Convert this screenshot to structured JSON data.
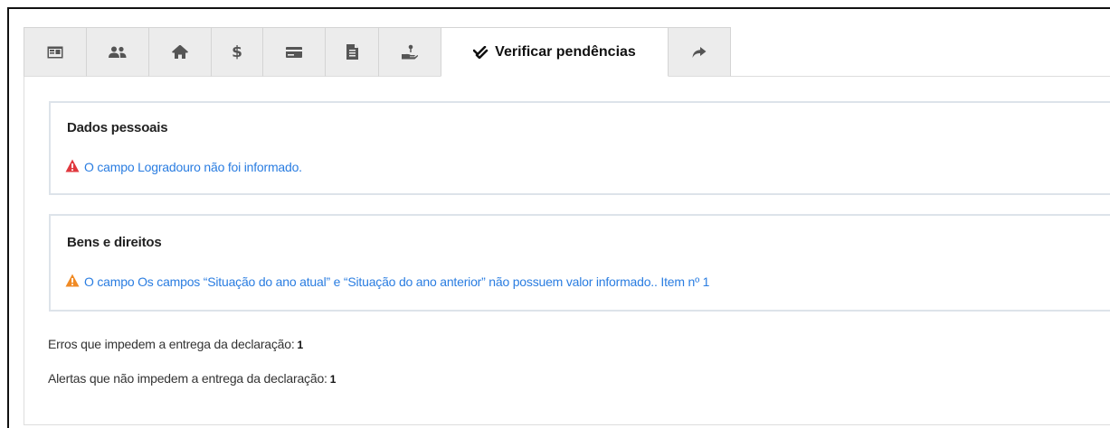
{
  "tabs": [
    {
      "icon": "id-card-icon",
      "label": ""
    },
    {
      "icon": "users-icon",
      "label": ""
    },
    {
      "icon": "home-icon",
      "label": ""
    },
    {
      "icon": "dollar-icon",
      "label": "$"
    },
    {
      "icon": "credit-card-icon",
      "label": ""
    },
    {
      "icon": "document-icon",
      "label": ""
    },
    {
      "icon": "hand-coin-icon",
      "label": ""
    },
    {
      "icon": "check-double-icon",
      "label": "Verificar pendências",
      "active": true
    },
    {
      "icon": "share-arrow-icon",
      "label": ""
    }
  ],
  "sections": [
    {
      "title": "Dados pessoais",
      "severity": "error",
      "severity_color": "#e0383e",
      "message": "O campo Logradouro não foi informado."
    },
    {
      "title": "Bens e direitos",
      "severity": "warning",
      "severity_color": "#f08a24",
      "message": "O campo Os campos “Situação do ano atual” e “Situação do ano anterior” não possuem valor informado.. Item nº 1"
    }
  ],
  "summary": {
    "errors_label": "Erros que impedem a entrega da declaração:",
    "errors_count": "1",
    "alerts_label": "Alertas que não impedem a entrega da declaração:",
    "alerts_count": "1"
  },
  "colors": {
    "link": "#2a7de1",
    "tab_inactive_bg": "#ececec",
    "border": "#dde3ea"
  }
}
